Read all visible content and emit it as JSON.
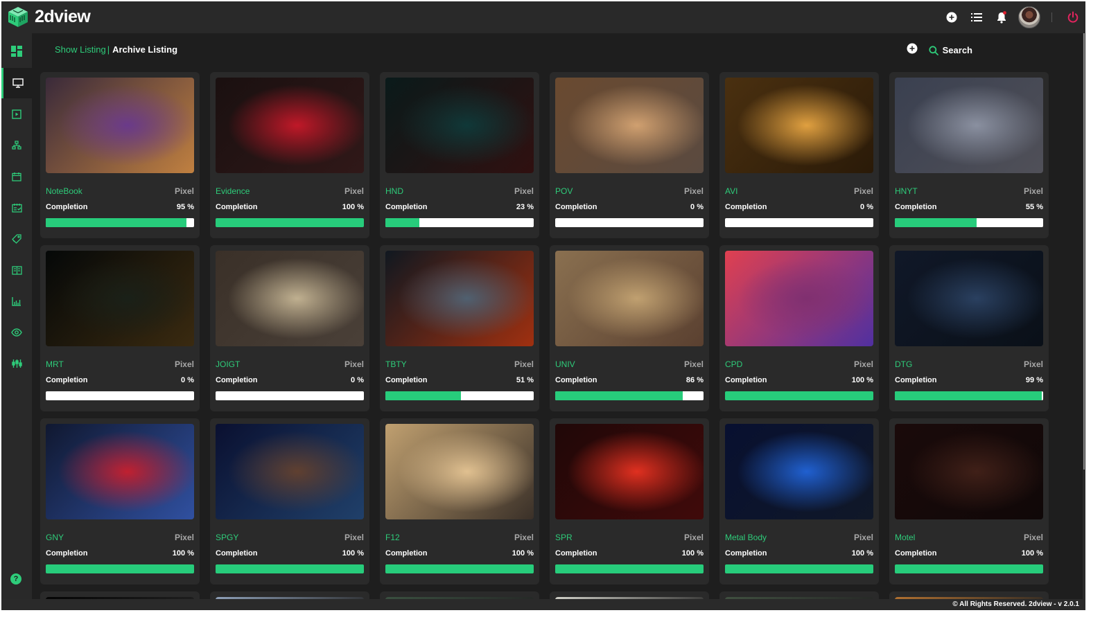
{
  "app": {
    "name": "2dview",
    "accent": "#2ecc7a",
    "danger": "#e0245e"
  },
  "topbar": {
    "icons": [
      "add-circle-icon",
      "list-icon",
      "bell-icon",
      "avatar",
      "power-icon"
    ],
    "notification_dot": true
  },
  "breadcrumb": {
    "show_listing": "Show Listing",
    "separator": "|",
    "archive_listing": "Archive Listing"
  },
  "actions": {
    "add_icon": "plus-circle-icon",
    "search_label": "Search"
  },
  "sidebar": {
    "items": [
      {
        "name": "dashboard",
        "icon": "dashboard-grid-icon",
        "active": false
      },
      {
        "name": "monitor",
        "icon": "monitor-icon",
        "active": true
      },
      {
        "name": "media",
        "icon": "play-square-icon",
        "active": false
      },
      {
        "name": "hierarchy",
        "icon": "hierarchy-icon",
        "active": false
      },
      {
        "name": "calendar",
        "icon": "calendar-icon",
        "active": false
      },
      {
        "name": "schedule",
        "icon": "calendar-check-icon",
        "active": false
      },
      {
        "name": "tags",
        "icon": "tag-icon",
        "active": false
      },
      {
        "name": "docs",
        "icon": "book-icon",
        "active": false
      },
      {
        "name": "reports",
        "icon": "bar-chart-icon",
        "active": false
      },
      {
        "name": "review",
        "icon": "eye-icon",
        "active": false
      },
      {
        "name": "settings",
        "icon": "sliders-icon",
        "active": false
      }
    ],
    "help_label": "?"
  },
  "completion_label": "Completion",
  "projects": [
    {
      "title": "NoteBook",
      "type": "Pixel",
      "completion": 95,
      "completion_text": "95 %"
    },
    {
      "title": "Evidence",
      "type": "Pixel",
      "completion": 100,
      "completion_text": "100 %"
    },
    {
      "title": "HND",
      "type": "Pixel",
      "completion": 23,
      "completion_text": "23 %"
    },
    {
      "title": "POV",
      "type": "Pixel",
      "completion": 0,
      "completion_text": "0 %"
    },
    {
      "title": "AVI",
      "type": "Pixel",
      "completion": 0,
      "completion_text": "0 %"
    },
    {
      "title": "HNYT",
      "type": "Pixel",
      "completion": 55,
      "completion_text": "55 %"
    },
    {
      "title": "MRT",
      "type": "Pixel",
      "completion": 0,
      "completion_text": "0 %"
    },
    {
      "title": "JOIGT",
      "type": "Pixel",
      "completion": 0,
      "completion_text": "0 %"
    },
    {
      "title": "TBTY",
      "type": "Pixel",
      "completion": 51,
      "completion_text": "51 %"
    },
    {
      "title": "UNIV",
      "type": "Pixel",
      "completion": 86,
      "completion_text": "86 %"
    },
    {
      "title": "CPD",
      "type": "Pixel",
      "completion": 100,
      "completion_text": "100 %"
    },
    {
      "title": "DTG",
      "type": "Pixel",
      "completion": 99,
      "completion_text": "99 %"
    },
    {
      "title": "GNY",
      "type": "Pixel",
      "completion": 100,
      "completion_text": "100 %"
    },
    {
      "title": "SPGY",
      "type": "Pixel",
      "completion": 100,
      "completion_text": "100 %"
    },
    {
      "title": "F12",
      "type": "Pixel",
      "completion": 100,
      "completion_text": "100 %"
    },
    {
      "title": "SPR",
      "type": "Pixel",
      "completion": 100,
      "completion_text": "100 %"
    },
    {
      "title": "Metal Body",
      "type": "Pixel",
      "completion": 100,
      "completion_text": "100 %"
    },
    {
      "title": "Motel",
      "type": "Pixel",
      "completion": 100,
      "completion_text": "100 %"
    }
  ],
  "thumb_colors": [
    [
      "#3a2a3a",
      "#6a3a8a",
      "#c08040"
    ],
    [
      "#1a1010",
      "#c01828",
      "#301818"
    ],
    [
      "#0a1a1a",
      "#103838",
      "#301010"
    ],
    [
      "#6a4a30",
      "#d0a070",
      "#5a4a40"
    ],
    [
      "#4a3010",
      "#e0a040",
      "#2a1a08"
    ],
    [
      "#3a4050",
      "#8a90a0",
      "#505058"
    ],
    [
      "#050808",
      "#1a2018",
      "#3a2a10"
    ],
    [
      "#3a3028",
      "#c0b090",
      "#4a4038"
    ],
    [
      "#101820",
      "#506070",
      "#a03010"
    ],
    [
      "#8a7050",
      "#c0a070",
      "#5a4030"
    ],
    [
      "#e04050",
      "#803070",
      "#5030a0"
    ],
    [
      "#101828",
      "#2a4060",
      "#0a1018"
    ],
    [
      "#101830",
      "#c02030",
      "#3050a0"
    ],
    [
      "#0a1030",
      "#604030",
      "#20406a"
    ],
    [
      "#c0a070",
      "#e0c090",
      "#3a3028"
    ],
    [
      "#200808",
      "#e03020",
      "#400a0a"
    ],
    [
      "#081030",
      "#2060d0",
      "#101828"
    ],
    [
      "#1a0a0a",
      "#402018",
      "#100808"
    ]
  ],
  "partial_row_colors": [
    "#050505",
    "#8ea0b8",
    "#3a5040",
    "#d0d0c8",
    "#405040",
    "#b07030"
  ],
  "footer": {
    "text": "© All Rights Reserved. 2dview - v 2.0.1"
  }
}
